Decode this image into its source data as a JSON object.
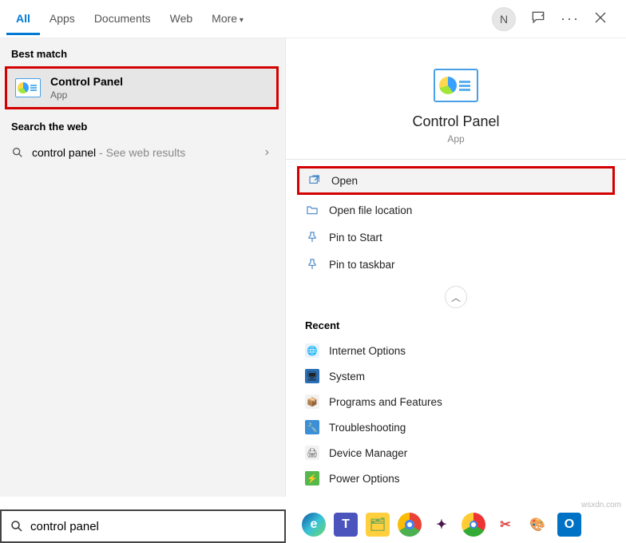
{
  "tabs": {
    "all": "All",
    "apps": "Apps",
    "documents": "Documents",
    "web": "Web",
    "more": "More"
  },
  "user_initial": "N",
  "left": {
    "best_match_label": "Best match",
    "best_match": {
      "title": "Control Panel",
      "subtitle": "App"
    },
    "search_web_label": "Search the web",
    "web_result": {
      "query": "control panel",
      "hint": " - See web results"
    }
  },
  "detail": {
    "title": "Control Panel",
    "subtitle": "App",
    "actions": {
      "open": "Open",
      "open_location": "Open file location",
      "pin_start": "Pin to Start",
      "pin_taskbar": "Pin to taskbar"
    },
    "recent_label": "Recent",
    "recent": [
      "Internet Options",
      "System",
      "Programs and Features",
      "Troubleshooting",
      "Device Manager",
      "Power Options"
    ]
  },
  "search_value": "control panel",
  "watermark": "wsxdn.com"
}
